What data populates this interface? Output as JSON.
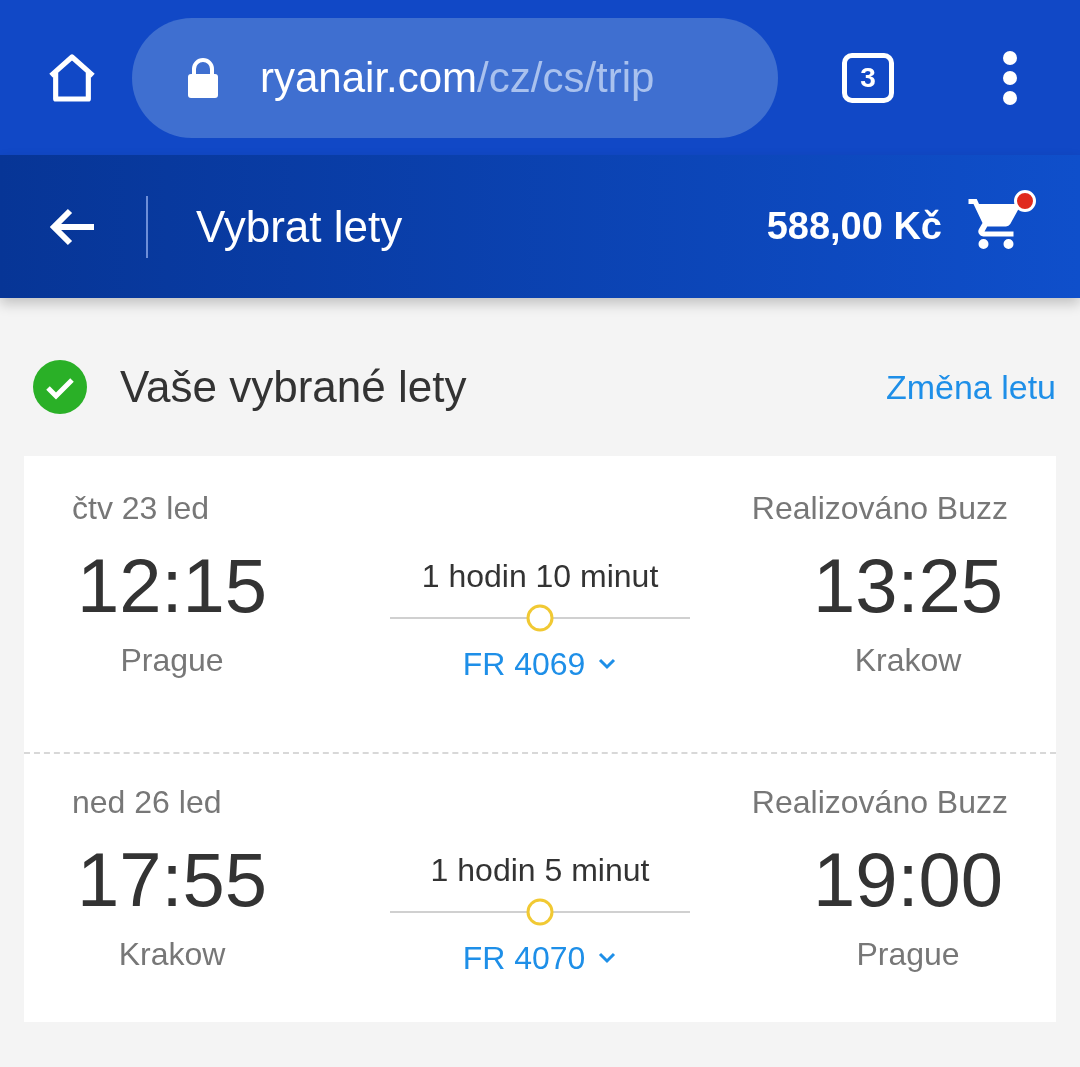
{
  "browser": {
    "url_domain": "ryanair.com",
    "url_path": "/cz/cs/trip",
    "tab_count": "3"
  },
  "header": {
    "title": "Vybrat lety",
    "price": "588,00 Kč",
    "cart_notification": true
  },
  "section": {
    "title": "Vaše vybrané lety",
    "link": "Změna letu"
  },
  "flights": [
    {
      "date": "čtv 23 led",
      "operator": "Realizováno Buzz",
      "depart_time": "12:15",
      "depart_city": "Prague",
      "duration": "1 hodin 10 minut",
      "arrive_time": "13:25",
      "arrive_city": "Krakow",
      "flight_number": "FR 4069"
    },
    {
      "date": "ned 26 led",
      "operator": "Realizováno Buzz",
      "depart_time": "17:55",
      "depart_city": "Krakow",
      "duration": "1 hodin 5 minut",
      "arrive_time": "19:00",
      "arrive_city": "Prague",
      "flight_number": "FR 4070"
    }
  ]
}
